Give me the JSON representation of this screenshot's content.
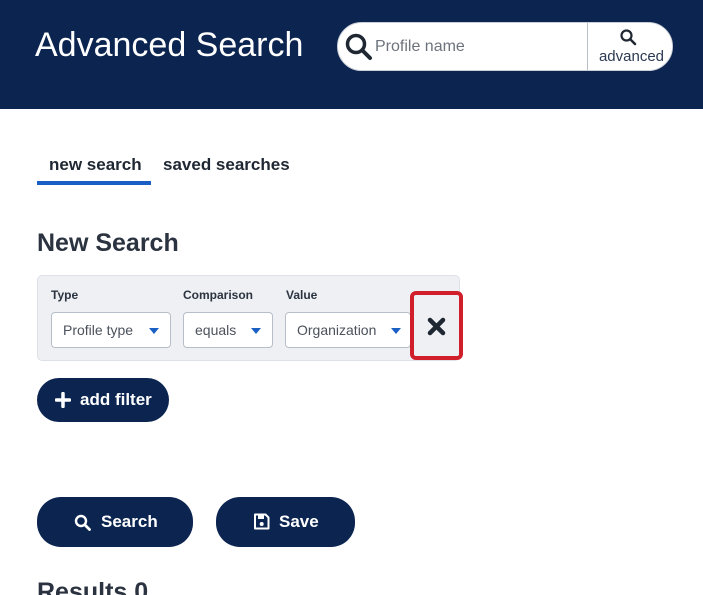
{
  "header": {
    "title": "Advanced Search",
    "search": {
      "placeholder": "Profile name",
      "value": "",
      "icon": "search-icon"
    },
    "advanced_label": "advanced"
  },
  "tabs": [
    {
      "label": "new search",
      "active": true
    },
    {
      "label": "saved searches",
      "active": false
    }
  ],
  "section_title": "New Search",
  "filter": {
    "type": {
      "label": "Type",
      "value": "Profile type"
    },
    "comparison": {
      "label": "Comparison",
      "value": "equals"
    },
    "value": {
      "label": "Value",
      "value": "Organization"
    },
    "remove_icon": "close-icon",
    "remove_highlighted": true
  },
  "actions": {
    "add_filter_label": "add filter",
    "search_label": "Search",
    "save_label": "Save"
  },
  "results_label": "Results 0",
  "colors": {
    "header_bg": "#0b2450",
    "primary_button": "#0b2450",
    "tab_underline": "#1a5fc4",
    "caret": "#1a5fc4",
    "highlight": "#d01f2a",
    "panel_bg": "#eef0f3"
  }
}
